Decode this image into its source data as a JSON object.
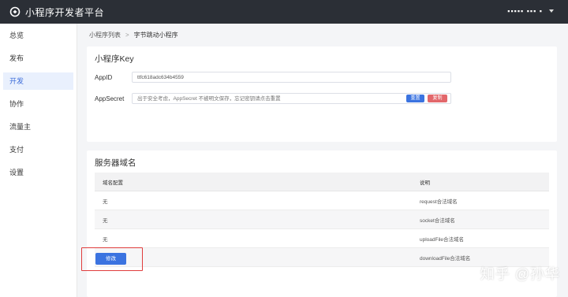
{
  "topbar": {
    "app_title": "小程序开发者平台",
    "user_name": "▪▪▪▪▪ ▪▪▪ ▪"
  },
  "sidebar": {
    "items": [
      {
        "label": "总览"
      },
      {
        "label": "发布"
      },
      {
        "label": "开发",
        "active": true
      },
      {
        "label": "协作"
      },
      {
        "label": "流量主"
      },
      {
        "label": "支付"
      },
      {
        "label": "设置"
      }
    ]
  },
  "breadcrumb": {
    "parent": "小程序列表",
    "separator": ">",
    "current": "字节跳动小程序"
  },
  "key_card": {
    "title": "小程序Key",
    "appid_label": "AppID",
    "appid_value": "ttfc618adc634b4559",
    "secret_label": "AppSecret",
    "secret_placeholder": "出于安全考虑，AppSecret 不被明文保存，忘记密钥请点击重置",
    "reset_label": "重置",
    "copy_label": "复制"
  },
  "domain_card": {
    "title": "服务器域名",
    "columns": [
      "域名配置",
      "说明"
    ],
    "rows": [
      {
        "config": "无",
        "desc": "request合法域名"
      },
      {
        "config": "无",
        "desc": "socket合法域名"
      },
      {
        "config": "无",
        "desc": "uploadFile合法域名"
      },
      {
        "config": "无",
        "desc": "downloadFile合法域名"
      }
    ],
    "modify_label": "修改"
  },
  "watermark": "知乎 @孙华",
  "colors": {
    "topbar_bg": "#2b2f36",
    "accent": "#3b73e0",
    "danger": "#e2676b",
    "highlight": "#e03c3c"
  }
}
